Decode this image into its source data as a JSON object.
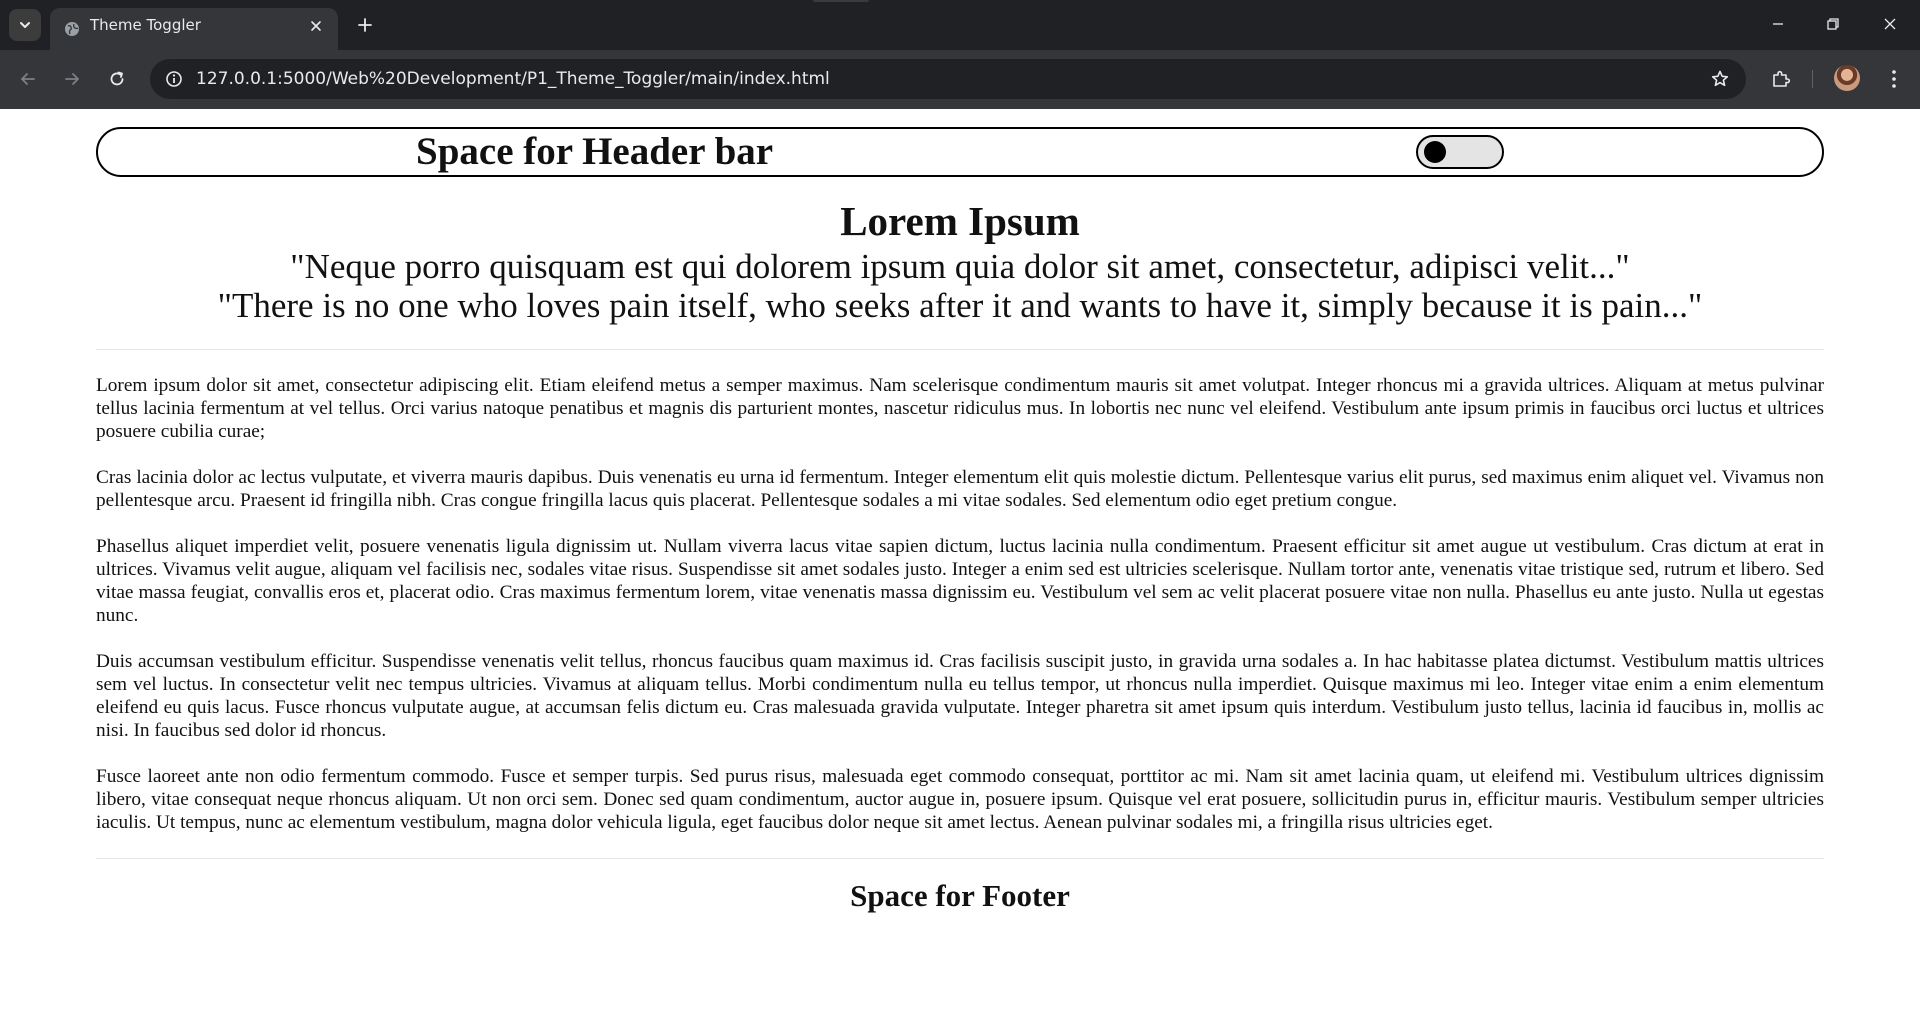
{
  "browser": {
    "tab": {
      "title": "Theme Toggler"
    },
    "address_bar": {
      "url": "127.0.0.1:5000/Web%20Development/P1_Theme_Toggler/main/index.html"
    }
  },
  "page": {
    "header": {
      "title": "Space for Header bar",
      "toggle": {
        "state": "off"
      }
    },
    "hero": {
      "title": "Lorem Ipsum",
      "quote_latin": "\"Neque porro quisquam est qui dolorem ipsum quia dolor sit amet, consectetur, adipisci velit...\"",
      "quote_english": "\"There is no one who loves pain itself, who seeks after it and wants to have it, simply because it is pain...\""
    },
    "paragraphs": [
      "Lorem ipsum dolor sit amet, consectetur adipiscing elit. Etiam eleifend metus a semper maximus. Nam scelerisque condimentum mauris sit amet volutpat. Integer rhoncus mi a gravida ultrices. Aliquam at metus pulvinar tellus lacinia fermentum at vel tellus. Orci varius natoque penatibus et magnis dis parturient montes, nascetur ridiculus mus. In lobortis nec nunc vel eleifend. Vestibulum ante ipsum primis in faucibus orci luctus et ultrices posuere cubilia curae;",
      "Cras lacinia dolor ac lectus vulputate, et viverra mauris dapibus. Duis venenatis eu urna id fermentum. Integer elementum elit quis molestie dictum. Pellentesque varius elit purus, sed maximus enim aliquet vel. Vivamus non pellentesque arcu. Praesent id fringilla nibh. Cras congue fringilla lacus quis placerat. Pellentesque sodales a mi vitae sodales. Sed elementum odio eget pretium congue.",
      "Phasellus aliquet imperdiet velit, posuere venenatis ligula dignissim ut. Nullam viverra lacus vitae sapien dictum, luctus lacinia nulla condimentum. Praesent efficitur sit amet augue ut vestibulum. Cras dictum at erat in ultrices. Vivamus velit augue, aliquam vel facilisis nec, sodales vitae risus. Suspendisse sit amet sodales justo. Integer a enim sed est ultricies scelerisque. Nullam tortor ante, venenatis vitae tristique sed, rutrum et libero. Sed vitae massa feugiat, convallis eros et, placerat odio. Cras maximus fermentum lorem, vitae venenatis massa dignissim eu. Vestibulum vel sem ac velit placerat posuere vitae non nulla. Phasellus eu ante justo. Nulla ut egestas nunc.",
      "Duis accumsan vestibulum efficitur. Suspendisse venenatis velit tellus, rhoncus faucibus quam maximus id. Cras facilisis suscipit justo, in gravida urna sodales a. In hac habitasse platea dictumst. Vestibulum mattis ultrices sem vel luctus. In consectetur velit nec tempus ultricies. Vivamus at aliquam tellus. Morbi condimentum nulla eu tellus tempor, ut rhoncus nulla imperdiet. Quisque maximus mi leo. Integer vitae enim a enim elementum eleifend eu quis lacus. Fusce rhoncus vulputate augue, at accumsan felis dictum eu. Cras malesuada gravida vulputate. Integer pharetra sit amet ipsum quis interdum. Vestibulum justo tellus, lacinia id faucibus in, mollis ac nisi. In faucibus sed dolor id rhoncus.",
      "Fusce laoreet ante non odio fermentum commodo. Fusce et semper turpis. Sed purus risus, malesuada eget commodo consequat, porttitor ac mi. Nam sit amet lacinia quam, ut eleifend mi. Vestibulum ultrices dignissim libero, vitae consequat neque rhoncus aliquam. Ut non orci sem. Donec sed quam condimentum, auctor augue in, posuere ipsum. Quisque vel erat posuere, sollicitudin purus in, efficitur mauris. Vestibulum semper ultricies iaculis. Ut tempus, nunc ac elementum vestibulum, magna dolor vehicula ligula, eget faucibus dolor neque sit amet lectus. Aenean pulvinar sodales mi, a fringilla risus ultricies eget."
    ],
    "footer": {
      "text": "Space for Footer"
    }
  },
  "colors": {
    "tabbar_bg": "#202124",
    "toolbar_bg": "#35363a",
    "omnibox_bg": "#202124",
    "page_bg": "#ffffff",
    "text": "#111111",
    "toggle_track": "#e4e4e4",
    "toggle_knob": "#000000"
  },
  "icons": {
    "tab_search": "chevron-down-icon",
    "favicon": "globe-icon",
    "tab_close": "close-icon",
    "new_tab": "plus-icon",
    "back": "arrow-left-icon",
    "forward": "arrow-right-icon",
    "reload": "reload-icon",
    "site_info": "info-icon",
    "bookmark": "star-icon",
    "extensions": "puzzle-icon",
    "menu": "kebab-icon",
    "minimize": "minimize-icon",
    "restore": "restore-icon",
    "close_window": "close-icon"
  }
}
